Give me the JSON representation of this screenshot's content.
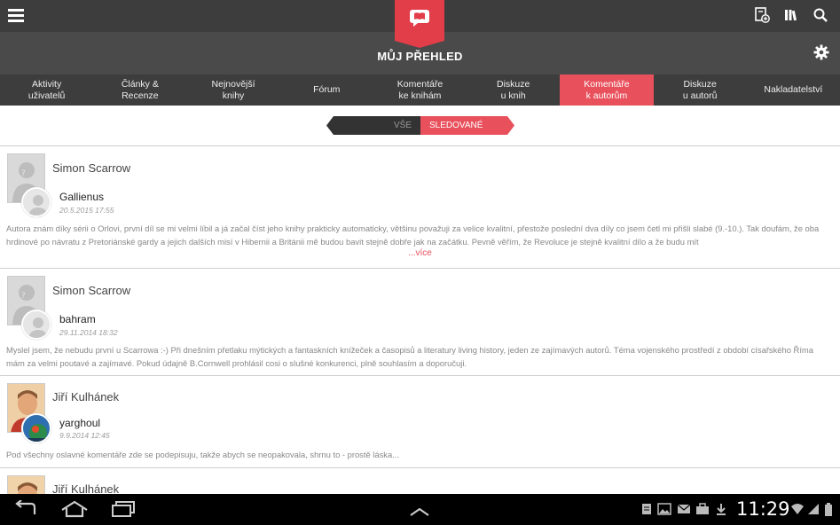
{
  "header": {
    "title": "MŮJ PŘEHLED"
  },
  "tabs": [
    {
      "label": "Aktivity\nuživatelů",
      "active": false
    },
    {
      "label": "Články &\nRecenze",
      "active": false
    },
    {
      "label": "Nejnovější\nknihy",
      "active": false
    },
    {
      "label": "Fórum",
      "active": false
    },
    {
      "label": "Komentáře\nke knihám",
      "active": false
    },
    {
      "label": "Diskuze\nu knih",
      "active": false
    },
    {
      "label": "Komentáře\nk autorům",
      "active": true
    },
    {
      "label": "Diskuze\nu autorů",
      "active": false
    },
    {
      "label": "Nakladatelství",
      "active": false
    }
  ],
  "filter": {
    "all_label": "VŠE",
    "followed_label": "SLEDOVANÉ",
    "selected": "SLEDOVANÉ"
  },
  "feed": [
    {
      "author": "Simon Scarrow",
      "user": "Gallienus",
      "date": "20.5.2015 17:55",
      "comment": "Autora znám díky sérii o Orlovi, první díl se mi velmi líbil a já začal číst jeho knihy prakticky automaticky, většinu považuji za velice kvalitní, přestože poslední dva díly co jsem četl mi přišli slabé (9.-10.). Tak doufám, že oba hrdinové po návratu z Pretoriánské gardy a jejich dalších misí v Hibernii a Británii mě budou bavit stejně dobře jak na začátku. Pevně věřím, že Revoluce je stejně kvalitní dílo a že budu mít",
      "more": "...více"
    },
    {
      "author": "Simon Scarrow",
      "user": "bahram",
      "date": "29.11.2014 18:32",
      "comment": "Myslel jsem, že nebudu první u Scarrowa :-) Při dnešním přetlaku mýtických a fantaskních knížeček a časopisů a literatury living history, jeden ze zajímavých autorů. Téma vojenského prostředí z období císařského Říma mám za velmi poutavé a zajímavé. Pokud údajně B.Cornwell prohlásil cosi o slušné konkurenci, plně souhlasím a doporučuji."
    },
    {
      "author": "Jiří Kulhánek",
      "user": "yarghoul",
      "date": "9.9.2014 12:45",
      "comment": "Pod všechny oslavné komentáře zde se podepisuju, takže abych se neopakovala, shrnu to - prostě láska..."
    },
    {
      "author": "Jiří Kulhánek"
    }
  ],
  "system": {
    "clock": "11:29"
  },
  "colors": {
    "accent": "#e8505c",
    "bar_dark": "#3d3d3d"
  }
}
